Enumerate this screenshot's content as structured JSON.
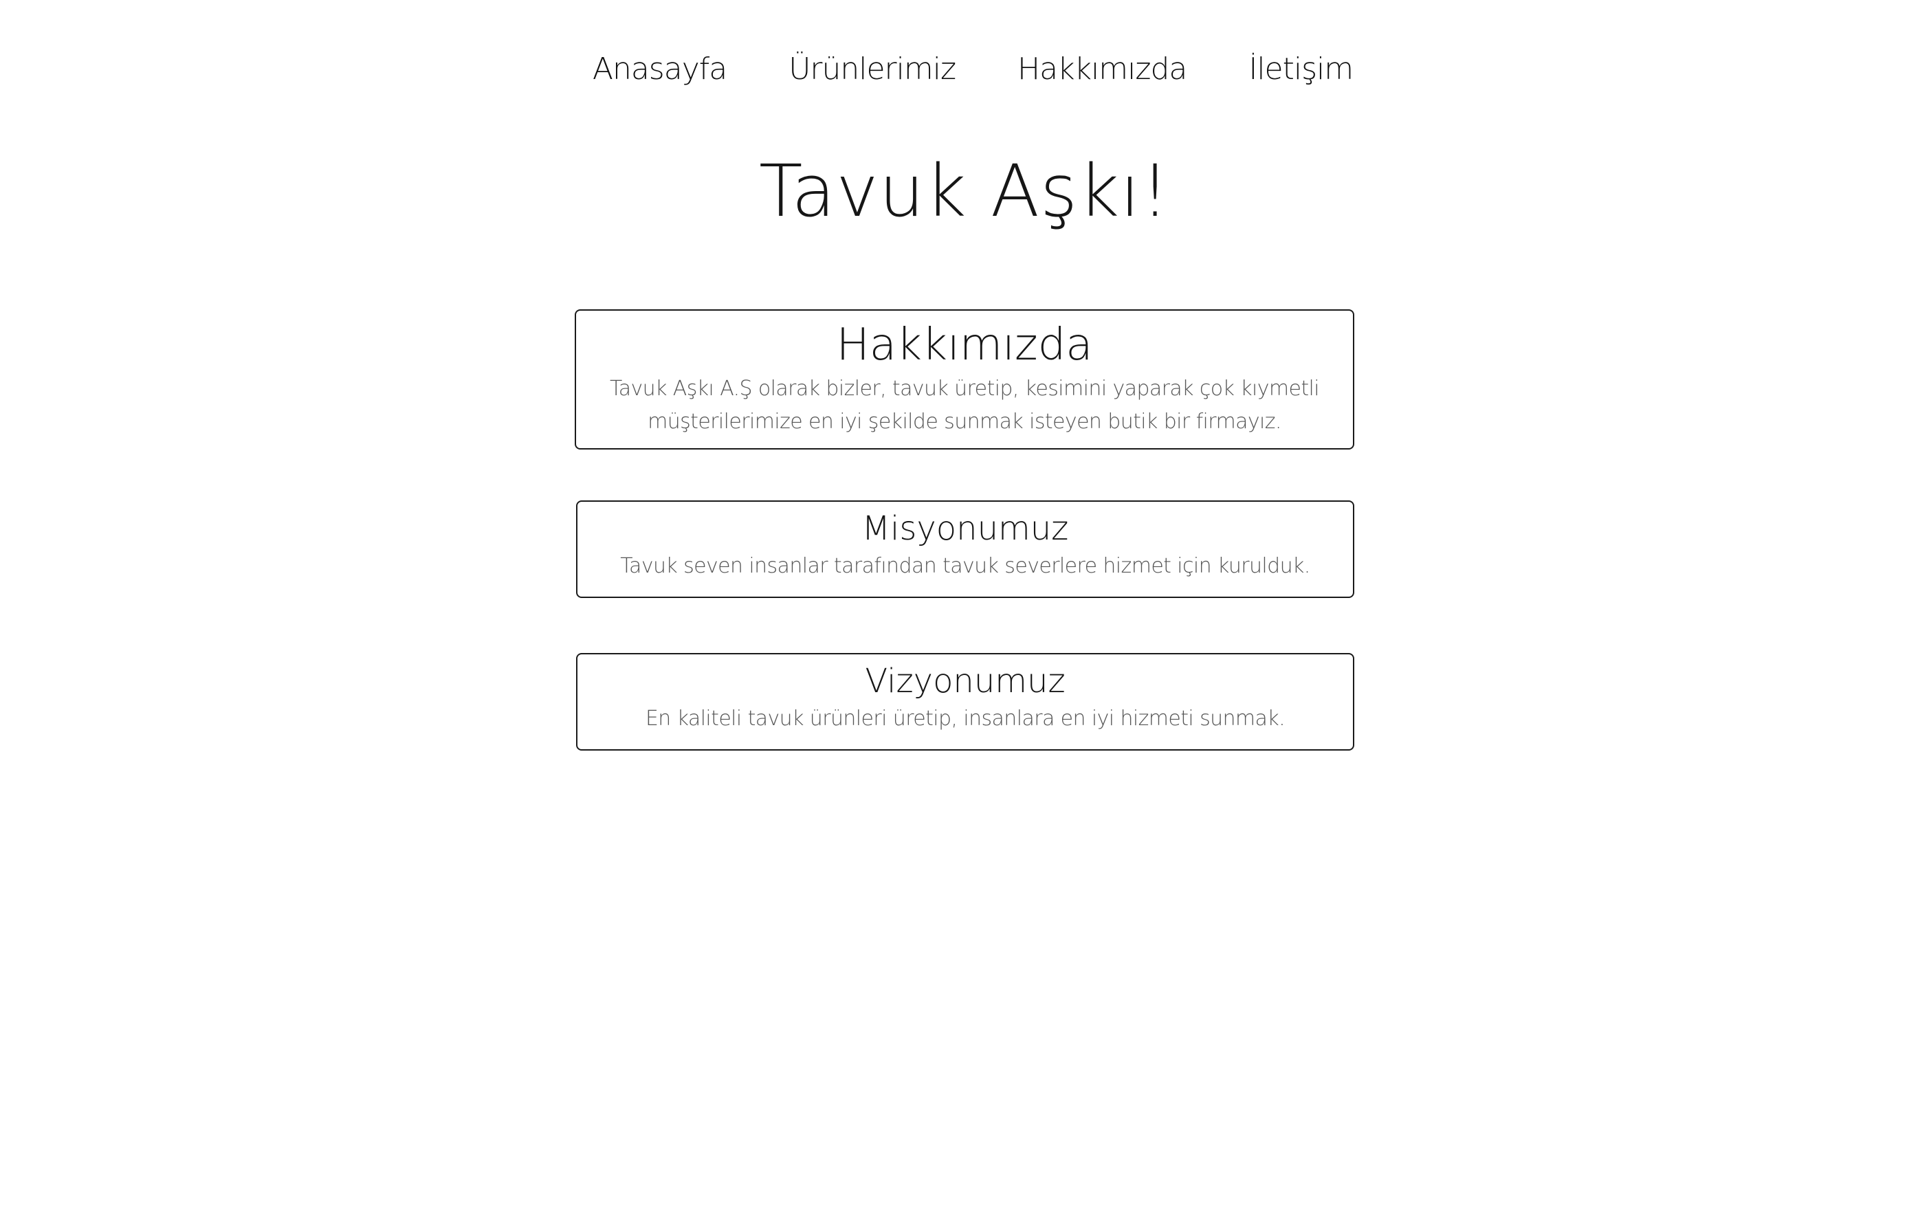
{
  "nav": {
    "items": [
      {
        "label": "Anasayfa"
      },
      {
        "label": "Ürünlerimiz"
      },
      {
        "label": "Hakkımızda"
      },
      {
        "label": "İletişim"
      }
    ]
  },
  "page": {
    "title": "Tavuk Aşkı!"
  },
  "sections": [
    {
      "title": "Hakkımızda",
      "text": "Tavuk Aşkı A.Ş olarak bizler, tavuk üretip, kesimini yaparak çok kıymetli müşterilerimize en iyi şekilde sunmak isteyen butik bir firmayız."
    },
    {
      "title": "Misyonumuz",
      "text": "Tavuk seven insanlar tarafından tavuk severlere hizmet için kurulduk."
    },
    {
      "title": "Vizyonumuz",
      "text": "En kaliteli tavuk ürünleri üretip, insanlara en iyi hizmeti sunmak."
    }
  ],
  "colors": {
    "background": "#ffffff",
    "text": "#111111",
    "muted_text": "#555555",
    "border": "#1a1a1a"
  }
}
